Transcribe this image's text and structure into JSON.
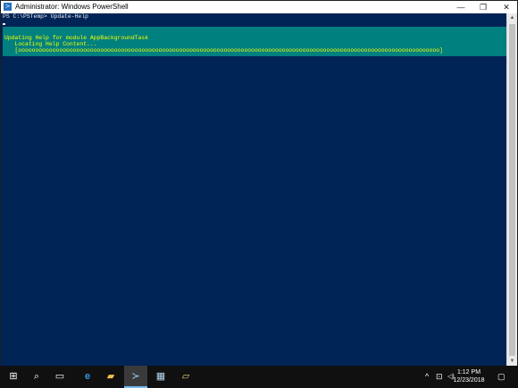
{
  "window": {
    "title": "Administrator: Windows PowerShell",
    "icon": "powershell-icon",
    "minimize_glyph": "—",
    "maximize_glyph": "❐",
    "close_glyph": "✕"
  },
  "console": {
    "prompt_line": "PS C:\\PSTemp> Update-Help",
    "background": "#012456",
    "text_color": "#eeedf0"
  },
  "progress": {
    "line1": "Updating Help for module AppBackgroundTask",
    "line2": "   Locating Help Content...",
    "line3": "   [ooooooooooooooooooooooooooooooooooooooooooooooooooooooooooooooooooooooooooooooooooooooooooooooooooooooooooooooooooooooooooo]",
    "background": "#00807f",
    "text_color": "#ffff00"
  },
  "taskbar": {
    "items": [
      {
        "name": "start-icon",
        "glyph": "⊞"
      },
      {
        "name": "search-icon",
        "glyph": "⌕"
      },
      {
        "name": "task-view-icon",
        "glyph": "▭"
      },
      {
        "name": "edge-icon",
        "glyph": "e"
      },
      {
        "name": "file-explorer-icon",
        "glyph": "▰"
      },
      {
        "name": "powershell-icon",
        "glyph": "≻"
      },
      {
        "name": "server-manager-icon",
        "glyph": "▦"
      },
      {
        "name": "notepad-icon",
        "glyph": "▱"
      }
    ],
    "tray": {
      "chevron_glyph": "^",
      "network_glyph": "⊡",
      "volume_glyph": "◁)",
      "notification_glyph": "▢"
    },
    "time": "1:12 PM",
    "date": "12/23/2018"
  }
}
